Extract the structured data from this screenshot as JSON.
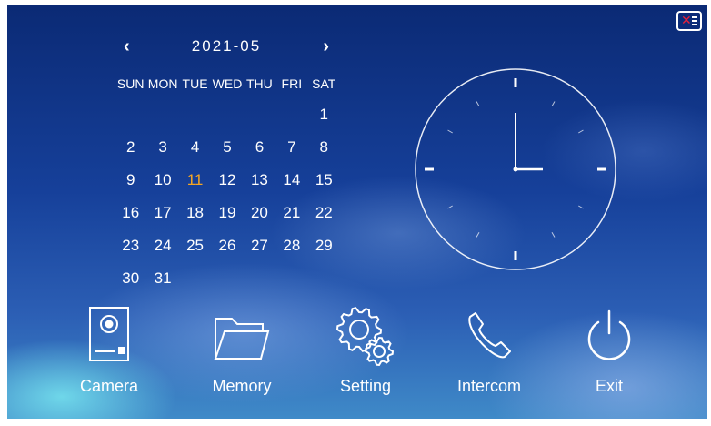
{
  "status": {
    "notify_icon": "message-alert-icon",
    "alert_color": "#e8203a"
  },
  "calendar": {
    "prev": "‹",
    "next": "›",
    "month": "2021-05",
    "weekdays": [
      "SUN",
      "MON",
      "TUE",
      "WED",
      "THU",
      "FRI",
      "SAT"
    ],
    "days": [
      [
        "",
        "",
        "",
        "",
        "",
        "",
        "1"
      ],
      [
        "2",
        "3",
        "4",
        "5",
        "6",
        "7",
        "8"
      ],
      [
        "9",
        "10",
        "11",
        "12",
        "13",
        "14",
        "15"
      ],
      [
        "16",
        "17",
        "18",
        "19",
        "20",
        "21",
        "22"
      ],
      [
        "23",
        "24",
        "25",
        "26",
        "27",
        "28",
        "29"
      ],
      [
        "30",
        "31",
        "",
        "",
        "",
        "",
        ""
      ]
    ],
    "today": "11",
    "today_color": "#f5a623"
  },
  "clock": {
    "time": "3:00"
  },
  "dock": [
    {
      "label": "Camera",
      "icon": "door-camera-icon"
    },
    {
      "label": "Memory",
      "icon": "folder-icon"
    },
    {
      "label": "Setting",
      "icon": "gears-icon"
    },
    {
      "label": "Intercom",
      "icon": "phone-icon"
    },
    {
      "label": "Exit",
      "icon": "power-icon"
    }
  ]
}
